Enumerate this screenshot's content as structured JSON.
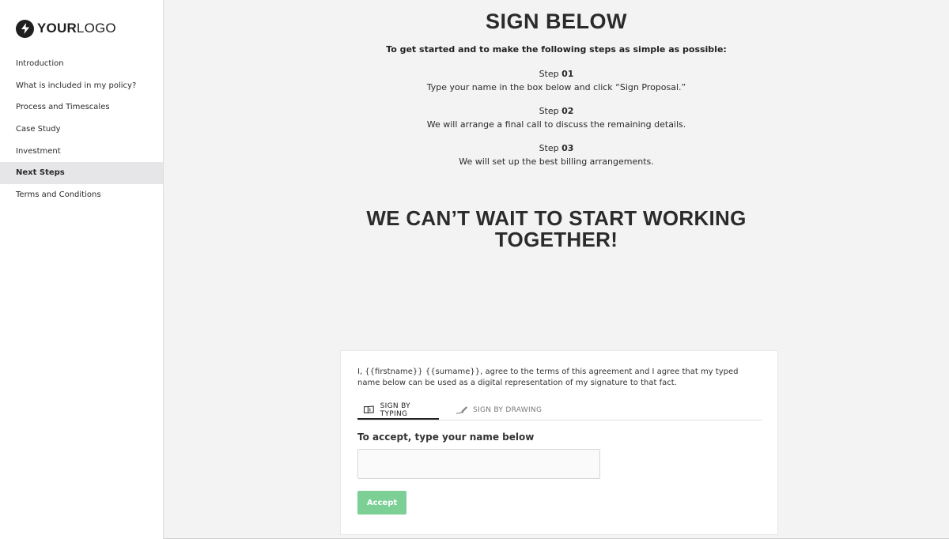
{
  "brand": {
    "logo_bold": "YOUR",
    "logo_light": "LOGO",
    "icon": "lightning-bolt-icon"
  },
  "sidebar": {
    "items": [
      {
        "label": "Introduction",
        "active": false
      },
      {
        "label": "What is included in my policy?",
        "active": false
      },
      {
        "label": "Process and Timescales",
        "active": false
      },
      {
        "label": "Case Study",
        "active": false
      },
      {
        "label": "Investment",
        "active": false
      },
      {
        "label": "Next Steps",
        "active": true
      },
      {
        "label": "Terms and Conditions",
        "active": false
      }
    ]
  },
  "main": {
    "title": "SIGN BELOW",
    "intro": "To get started and to make the following steps as simple as possible:",
    "steps": [
      {
        "prefix": "Step",
        "num": "01",
        "text": "Type your name in the box below and click “Sign Proposal.”"
      },
      {
        "prefix": "Step",
        "num": "02",
        "text": "We will arrange a final call to discuss the remaining details."
      },
      {
        "prefix": "Step",
        "num": "03",
        "text": "We will set up the best billing arrangements."
      }
    ],
    "headline_line1": "WE CAN’T WAIT TO START WORKING",
    "headline_line2": "TOGETHER!"
  },
  "sign_card": {
    "agreement": "I, {{firstname}} {{surname}}, agree to the terms of this agreement and I agree that my typed name below can be used as a digital representation of my signature to that fact.",
    "tabs": [
      {
        "label": "SIGN BY TYPING",
        "icon": "keyboard-sign-icon",
        "active": true
      },
      {
        "label": "SIGN BY DRAWING",
        "icon": "pen-draw-icon",
        "active": false
      }
    ],
    "accept_label": "To accept, type your name below",
    "name_value": "",
    "accept_button": "Accept"
  },
  "colors": {
    "accept_button": "#7ccf95",
    "active_nav_bg": "#e6e6e9",
    "main_bg": "#f3f3f3"
  }
}
